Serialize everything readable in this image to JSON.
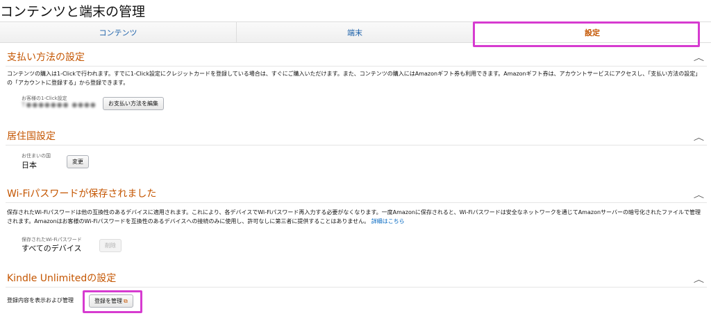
{
  "page": {
    "title": "コンテンツと端末の管理"
  },
  "tabs": [
    {
      "label": "コンテンツ"
    },
    {
      "label": "端末"
    },
    {
      "label": "設定"
    }
  ],
  "payment": {
    "title": "支払い方法の設定",
    "description": "コンテンツの購入は1-Clickで行われます。すでに1-Click設定にクレジットカードを登録している場合は、すぐにご購入いただけます。また、コンテンツの購入にはAmazonギフト券も利用できます。Amazonギフト券は、アカウントサービスにアクセスし、「支払い方法の設定」の「アカウントに登録する」から登録できます。",
    "field_label": "お客様の1-Click設定",
    "field_value": "T●●●●●●● ●●●●",
    "edit_button": "お支払い方法を編集"
  },
  "residence": {
    "title": "居住国設定",
    "field_label": "お住まいの国",
    "field_value": "日本",
    "change_button": "変更"
  },
  "wifi": {
    "title": "Wi-Fiパスワードが保存されました",
    "description": "保存されたWi-Fiパスワードは他の互換性のあるデバイスに適用されます。これにより、各デバイスでWi-Fiパスワード再入力する必要がなくなります。一度Amazonに保存されると、Wi-Fiパスワードは安全なネットワークを通じてAmazonサーバーの暗号化されたファイルで管理されます。Amazonはお客様のWi-Fiパスワードを互換性のあるデバイスへの接続のみに使用し、許可なしに第三者に提供することはありません。",
    "details_link": "詳細はこちら",
    "field_label": "保存されたWi-Fiパスワード",
    "field_value": "すべてのデバイス",
    "delete_button": "削除"
  },
  "kindle": {
    "title": "Kindle Unlimitedの設定",
    "row_label": "登録内容を表示および管理",
    "manage_button": "登録を管理"
  },
  "icons": {
    "chevron": "chevron-up-icon",
    "external": "external-link-icon"
  },
  "colors": {
    "section_title": "#c45500",
    "tab_active": "#c45500",
    "tab_inactive": "#1a5fa8",
    "link": "#0066c0",
    "highlight": "#d63bd0"
  }
}
